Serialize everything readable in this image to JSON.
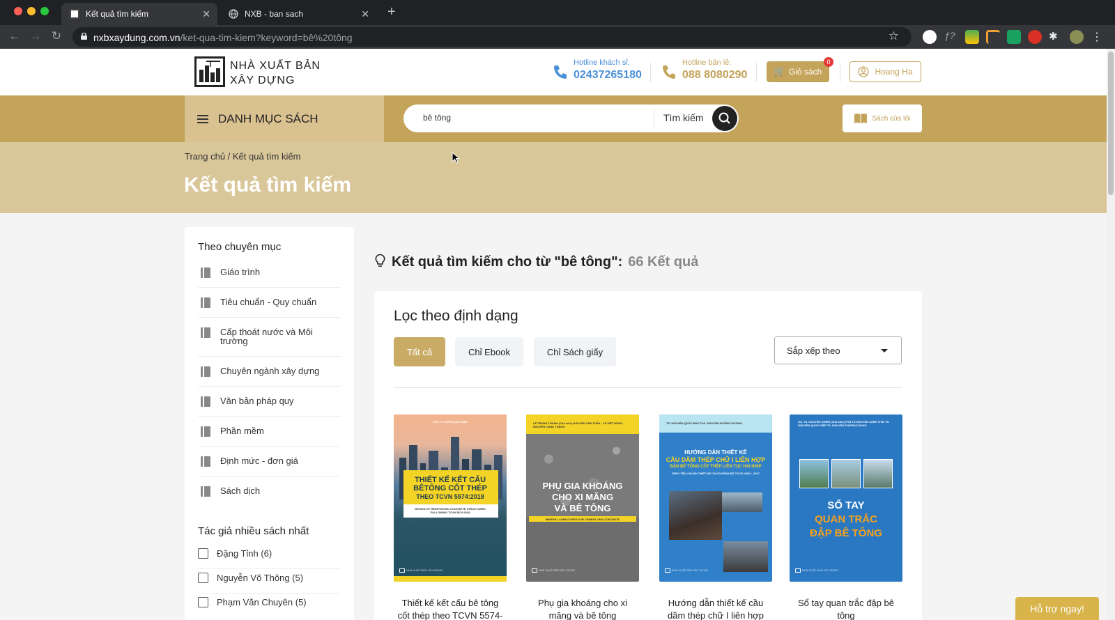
{
  "browser": {
    "tabs": [
      {
        "title": "Kết quả tìm kiếm",
        "active": true
      },
      {
        "title": "NXB - ban sach",
        "active": false
      }
    ],
    "url_host": "nxbxaydung.com.vn",
    "url_path": "/ket-qua-tim-kiem?keyword=bê%20tông",
    "colors": {
      "close": "#ff5f57",
      "minimize": "#febc2e",
      "maximize": "#28c840"
    }
  },
  "header": {
    "logo_line1": "NHÀ XUẤT BẢN",
    "logo_line2": "XÂY DỰNG",
    "hotline_wholesale_label": "Hotline khách sỉ:",
    "hotline_wholesale": "02437265180",
    "hotline_retail_label": "Hotline bán lẻ:",
    "hotline_retail": "088 8080290",
    "cart_label": "Giỏ sách",
    "cart_count": "0",
    "user_name": "Hoang Ha",
    "colors": {
      "blue": "#4a90d9",
      "gold": "#c4a35a"
    }
  },
  "nav": {
    "menu_label": "DANH MỤC SÁCH",
    "search_value": "bê tông",
    "search_label": "Tìm kiếm",
    "my_books_label": "Sách của tôi"
  },
  "hero": {
    "breadcrumb": "Trang chủ / Kết quả tìm kiếm",
    "title": "Kết quả tìm kiếm"
  },
  "sidebar": {
    "categories_title": "Theo chuyên mục",
    "categories": [
      "Giáo trình",
      "Tiêu chuẩn - Quy chuẩn",
      "Cấp thoát nước và Môi trường",
      "Chuyên ngành xây dựng",
      "Văn bản pháp quy",
      "Phần mềm",
      "Định mức - đơn giá",
      "Sách dịch"
    ],
    "authors_title": "Tác giả nhiều sách nhất",
    "authors": [
      "Đặng Tỉnh (6)",
      "Nguyễn Võ Thông (5)",
      "Phạm Văn Chuyên (5)"
    ]
  },
  "results": {
    "heading": "Kết quả tìm kiếm cho từ \"bê tông\":",
    "count": "66 Kết quả",
    "filter_title": "Lọc theo định dạng",
    "filters": [
      "Tất cả",
      "Chỉ Ebook",
      "Chỉ Sách giấy"
    ],
    "active_filter": "Tất cả",
    "sort_label": "Sắp xếp theo",
    "books": [
      {
        "title_line1": "Thiết kế kết cấu bê tông",
        "title_line2": "cốt thép theo TCVN 5574-",
        "cover_author": "PGS. TS. NGÔ QUỐC BẢO",
        "cover_title1": "THIẾT KẾ KẾT CẤU",
        "cover_title2": "BÊTÔNG CỐT THÉP",
        "cover_title3": "THEO TCVN 5574:2018",
        "cover_sub": "DESIGN OF REINFORCED CONCRETE STRUCTURES FOLLOWING TCVN 5574:2018"
      },
      {
        "title_line1": "Phụ gia khoáng cho xi",
        "title_line2": "măng và bê tông",
        "cover_author": "LÊ TRUNG THÀNH (Chủ biên) NGUYỄN VĂN TUẤN - LÊ VIỆT HÙNG - NGUYỄN CÔNG THẮNG",
        "cover_title1": "PHỤ GIA KHOÁNG",
        "cover_title2": "CHO XI MĂNG",
        "cover_title3": "VÀ BÊ TÔNG",
        "cover_sub": "MINERAL ADMIXTURES FOR CEMENT AND CONCRETE"
      },
      {
        "title_line1": "Hướng dẫn thiết kế cầu",
        "title_line2": "dầm thép chữ I liên hợp",
        "cover_author": "TS. NGUYỄN QUỐC BẢO ThS. NGUYỄN HƯỚNG DƯƠNG",
        "cover_title1": "HƯỚNG DẪN THIẾT KẾ",
        "cover_title2": "CẦU DẦM THÉP CHỮ I LIÊN HỢP",
        "cover_title3": "BẢN BÊ TÔNG CỐT THÉP LIÊN TỤC HAI NHỊP",
        "cover_sub": "THEO TIÊU CHUẨN THIẾT KẾ CẦU ĐƯỜNG BỘ TCVN 11823 - 2017"
      },
      {
        "title_line1": "Sổ tay quan trắc đập bê",
        "title_line2": "tông",
        "cover_author": "GS. TS. NGUYỄN CHIẾN (Chủ biên) PGS.TS NGUYỄN CẢNH THÁI TS. NGUYỄN QUỐC HIỆP TS. NGUYỄN PHƯƠNG DUNG",
        "cover_title1": "SỔ TAY",
        "cover_title2": "QUAN TRẮC",
        "cover_title3": "ĐẬP BÊ TÔNG",
        "cover_sub": ""
      }
    ],
    "publisher": "NHÀ XUẤT BẢN XÂY DỰNG"
  },
  "support_label": "Hỗ trợ ngay!"
}
